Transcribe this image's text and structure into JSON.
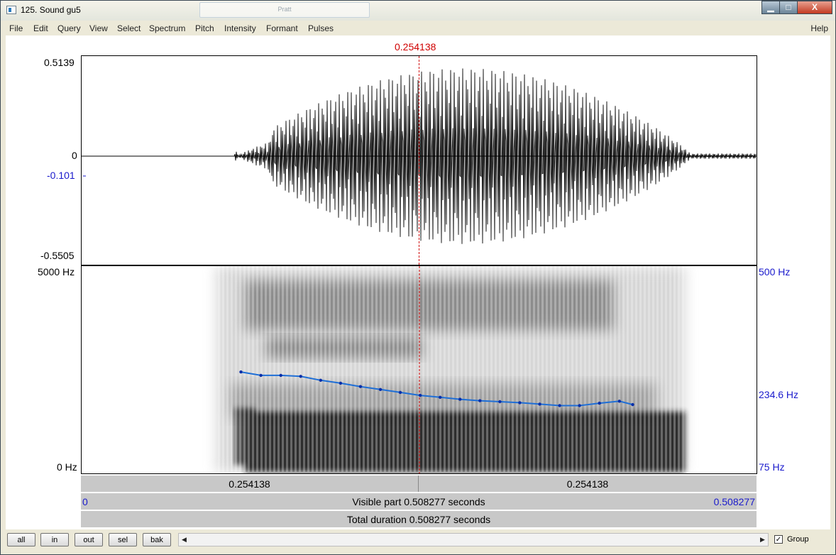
{
  "window": {
    "title": "125. Sound gu5",
    "title_center": "Pratt",
    "controls": {
      "minimize": "▁",
      "maximize": "□",
      "close": "X"
    }
  },
  "menu": {
    "items": [
      "File",
      "Edit",
      "Query",
      "View",
      "Select",
      "Spectrum",
      "Pitch",
      "Intensity",
      "Formant",
      "Pulses"
    ],
    "help": "Help"
  },
  "cursor": {
    "time": "0.254138"
  },
  "waveform": {
    "y_max": "0.5139",
    "y_zero": "0",
    "y_cursor_value": "-0.101",
    "y_min": "-0.5505"
  },
  "spectrogram": {
    "freq_top": "5000 Hz",
    "freq_bottom": "0 Hz",
    "pitch_top": "500 Hz",
    "pitch_cursor": "234.6 Hz",
    "pitch_bottom": "75 Hz"
  },
  "time_bar": {
    "left_segment": "0.254138",
    "right_segment": "0.254138",
    "visible_start": "0",
    "visible_label": "Visible part 0.508277 seconds",
    "visible_end": "0.508277",
    "total_label": "Total duration 0.508277 seconds"
  },
  "bottom": {
    "buttons": [
      "all",
      "in",
      "out",
      "sel",
      "bak"
    ],
    "group_label": "Group",
    "group_checked": true
  },
  "colors": {
    "cursor": "#d00000",
    "pitch_line": "#1f6fd6",
    "axis_label_blue": "#1a1acc"
  },
  "chart_data": {
    "type": "line",
    "x": [
      0.12,
      0.135,
      0.15,
      0.165,
      0.18,
      0.195,
      0.21,
      0.225,
      0.24,
      0.255,
      0.27,
      0.285,
      0.3,
      0.315,
      0.33,
      0.345,
      0.36,
      0.375,
      0.39,
      0.405,
      0.415
    ],
    "series": [
      {
        "values": [
          283,
          276,
          276,
          274,
          266,
          260,
          253,
          247,
          241,
          235,
          231,
          227,
          224,
          222,
          220,
          217,
          214,
          214,
          219,
          223,
          216
        ]
      }
    ],
    "xlim": [
      0,
      0.508277
    ],
    "ylim": [
      75,
      500
    ]
  }
}
